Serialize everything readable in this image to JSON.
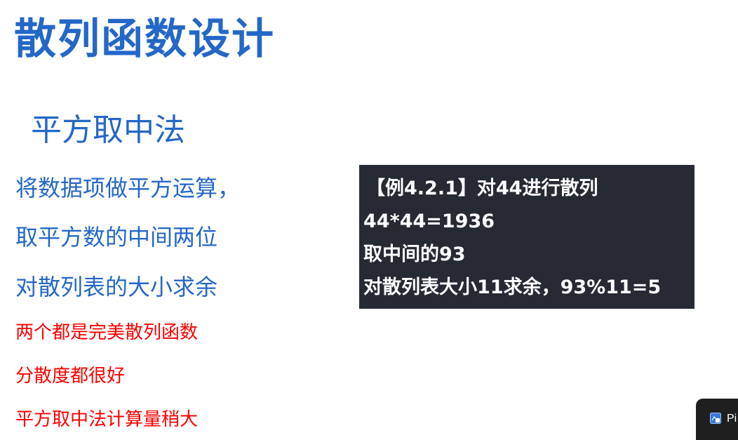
{
  "slide": {
    "title": "散列函数设计",
    "subtitle": "平方取中法",
    "steps": [
      "将数据项做平方运算，",
      "取平方数的中间两位",
      "对散列表的大小求余"
    ],
    "notes": [
      "两个都是完美散列函数",
      "分散度都很好",
      "平方取中法计算量稍大"
    ],
    "example": {
      "title": "【例4.2.1】对44进行散列",
      "lines": [
        "44*44=1936",
        "取中间的93",
        "对散列表大小11求余，93%11=5"
      ]
    }
  },
  "pip_button": {
    "label": "Pi",
    "icon": "picture-in-picture-icon"
  },
  "colors": {
    "heading_blue": "#2467c7",
    "note_red": "#ff0000",
    "example_bg": "#262a33"
  }
}
